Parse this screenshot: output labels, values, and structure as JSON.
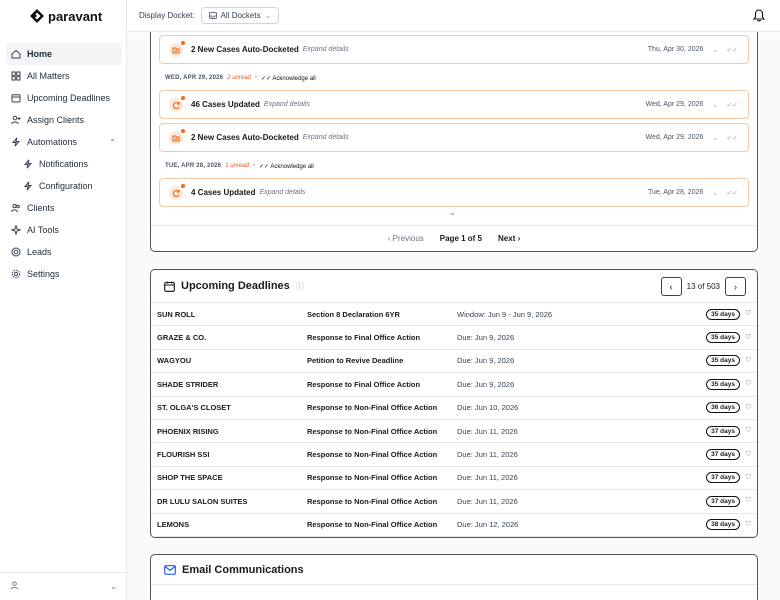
{
  "brand": "paravant",
  "topbar": {
    "docket_label": "Display Docket:",
    "docket_value": "All Dockets"
  },
  "nav": [
    {
      "label": "Home",
      "icon": "home-icon",
      "active": true
    },
    {
      "label": "All Matters",
      "icon": "grid-icon"
    },
    {
      "label": "Upcoming Deadlines",
      "icon": "calendar-icon"
    },
    {
      "label": "Assign Clients",
      "icon": "user-plus-icon"
    },
    {
      "label": "Automations",
      "icon": "bolt-icon",
      "expanded": true
    },
    {
      "label": "Notifications",
      "icon": "bolt-icon",
      "sub": true
    },
    {
      "label": "Configuration",
      "icon": "bolt-icon",
      "sub": true
    },
    {
      "label": "Clients",
      "icon": "users-icon"
    },
    {
      "label": "AI Tools",
      "icon": "sparkle-icon"
    },
    {
      "label": "Leads",
      "icon": "target-icon"
    },
    {
      "label": "Settings",
      "icon": "gear-icon"
    }
  ],
  "notifications": {
    "items": [
      {
        "title": "2 New Cases Auto-Docketed",
        "expand": "Expand details",
        "date": "Thu, Apr 30, 2026",
        "kind": "docket"
      },
      {
        "title": "46 Cases Updated",
        "expand": "Expand details",
        "date": "Wed, Apr 29, 2026",
        "kind": "update"
      },
      {
        "title": "2 New Cases Auto-Docketed",
        "expand": "Expand details",
        "date": "Wed, Apr 29, 2026",
        "kind": "docket"
      },
      {
        "title": "4 Cases Updated",
        "expand": "Expand details",
        "date": "Tue, Apr 28, 2026",
        "kind": "update"
      }
    ],
    "groups": [
      {
        "date": "WED, APR 29, 2026",
        "unread": "2 unread",
        "ack": "Acknowledge all"
      },
      {
        "date": "TUE, APR 28, 2026",
        "unread": "1 unread",
        "ack": "Acknowledge all"
      }
    ],
    "pager": {
      "prev": "Previous",
      "page": "Page 1 of 5",
      "next": "Next"
    }
  },
  "deadlines": {
    "title": "Upcoming Deadlines",
    "count": "13 of 503",
    "rows": [
      {
        "mark": "SUN ROLL",
        "action": "Section 8 Declaration 6YR",
        "due": "Window: Jun 9 - Jun 9, 2026",
        "days": "35 days"
      },
      {
        "mark": "GRAZE & CO.",
        "action": "Response to Final Office Action",
        "due": "Due: Jun 9, 2026",
        "days": "35 days"
      },
      {
        "mark": "WAGYOU",
        "action": "Petition to Revive Deadline",
        "due": "Due: Jun 9, 2026",
        "days": "35 days"
      },
      {
        "mark": "SHADE STRIDER",
        "action": "Response to Final Office Action",
        "due": "Due: Jun 9, 2026",
        "days": "35 days"
      },
      {
        "mark": "ST. OLGA'S CLOSET",
        "action": "Response to Non-Final Office Action",
        "due": "Due: Jun 10, 2026",
        "days": "36 days"
      },
      {
        "mark": "PHOENIX RISING",
        "action": "Response to Non-Final Office Action",
        "due": "Due: Jun 11, 2026",
        "days": "37 days"
      },
      {
        "mark": "FLOURISH SSI",
        "action": "Response to Non-Final Office Action",
        "due": "Due: Jun 11, 2026",
        "days": "37 days"
      },
      {
        "mark": "SHOP THE SPACE",
        "action": "Response to Non-Final Office Action",
        "due": "Due: Jun 11, 2026",
        "days": "37 days"
      },
      {
        "mark": "DR LULU SALON SUITES",
        "action": "Response to Non-Final Office Action",
        "due": "Due: Jun 11, 2026",
        "days": "37 days"
      },
      {
        "mark": "LEMONS",
        "action": "Response to Non-Final Office Action",
        "due": "Due: Jun 12, 2026",
        "days": "38 days"
      }
    ]
  },
  "email": {
    "title": "Email Communications"
  },
  "colors": {
    "accent": "#ea580c",
    "notif_border": "#f5c9a6",
    "email_icon": "#2563eb"
  }
}
